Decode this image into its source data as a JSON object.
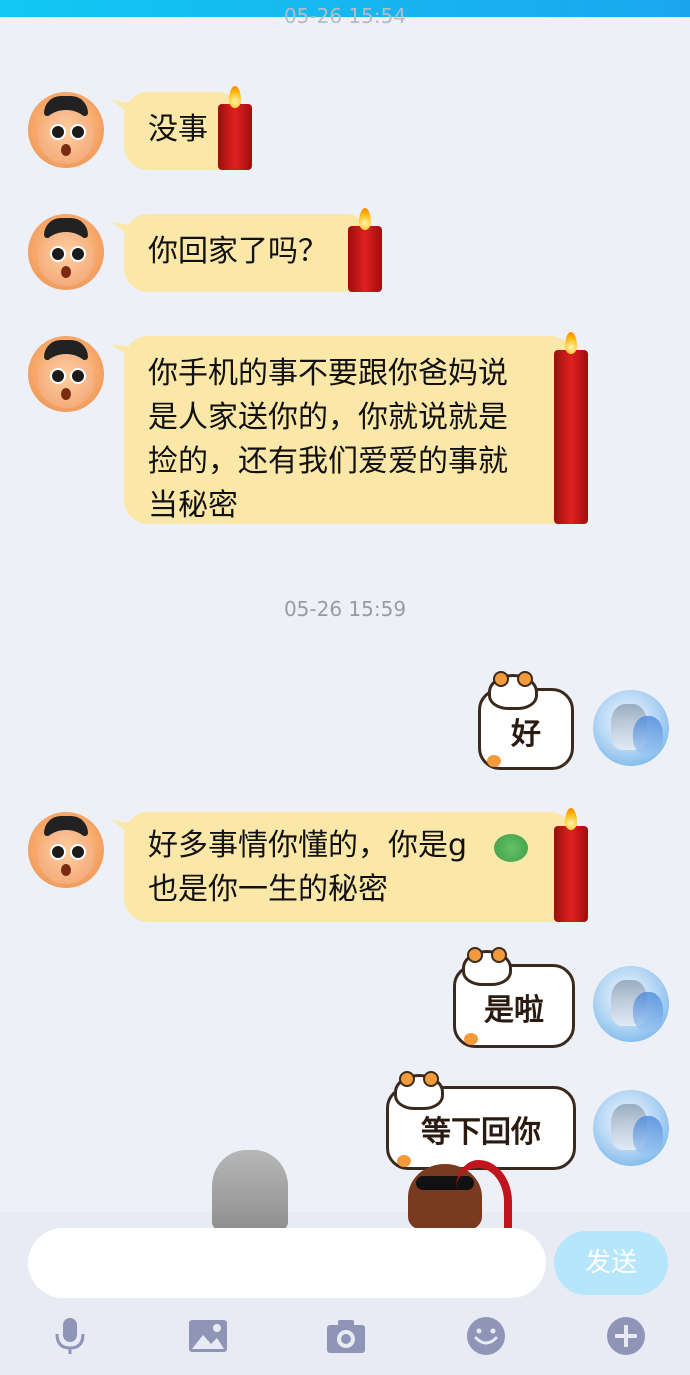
{
  "header": {
    "timestamp_partial": "05-26 15:54"
  },
  "messages": [
    {
      "side": "left",
      "text": "没事"
    },
    {
      "side": "left",
      "text": "你回家了吗？"
    },
    {
      "side": "left",
      "lines": [
        "你手机的事不要跟你爸妈说",
        "是人家送你的，你就说就是",
        "捡的，还有我们爱爱的事就",
        "当秘密"
      ]
    },
    {
      "side": "left",
      "lines": [
        "好多事情你懂的，你是g",
        "也是你一生的秘密"
      ]
    }
  ],
  "timestamp": "05-26 15:59",
  "stickers": [
    {
      "side": "right",
      "text": "好"
    },
    {
      "side": "right",
      "text": "是啦"
    },
    {
      "side": "right",
      "text": "等下回你"
    }
  ],
  "input": {
    "placeholder": "",
    "value": ""
  },
  "send_button": {
    "label": "发送"
  },
  "toolbar": [
    "microphone-icon",
    "image-icon",
    "camera-icon",
    "emoji-icon",
    "plus-icon"
  ],
  "colors": {
    "accent": "#12c8f3",
    "bubble": "#fbe8a9",
    "send_disabled": "#b6e6fb",
    "background": "#eef0f8"
  }
}
